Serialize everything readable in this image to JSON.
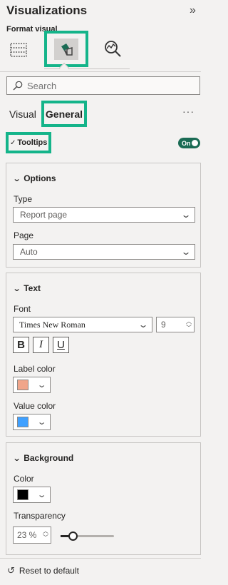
{
  "header": {
    "title": "Visualizations",
    "format_label": "Format visual"
  },
  "search": {
    "placeholder": "Search"
  },
  "subtabs": {
    "visual": "Visual",
    "general": "General",
    "more": "···"
  },
  "tooltips": {
    "label": "Tooltips",
    "toggle": "On"
  },
  "options": {
    "title": "Options",
    "type_label": "Type",
    "type_value": "Report page",
    "page_label": "Page",
    "page_value": "Auto"
  },
  "text": {
    "title": "Text",
    "font_label": "Font",
    "font_value": "Times New Roman",
    "font_size": "9",
    "bold": "B",
    "italic": "I",
    "underline": "U",
    "label_color_label": "Label color",
    "label_color": "#f0a58a",
    "value_color_label": "Value color",
    "value_color": "#3fa0ff"
  },
  "background": {
    "title": "Background",
    "color_label": "Color",
    "color": "#000000",
    "transparency_label": "Transparency",
    "transparency_value": "23 %",
    "transparency_fraction": 0.23
  },
  "footer": {
    "reset": "Reset to default"
  },
  "colors": {
    "accent": "#14b48a",
    "toggle_on": "#1a6b54"
  }
}
